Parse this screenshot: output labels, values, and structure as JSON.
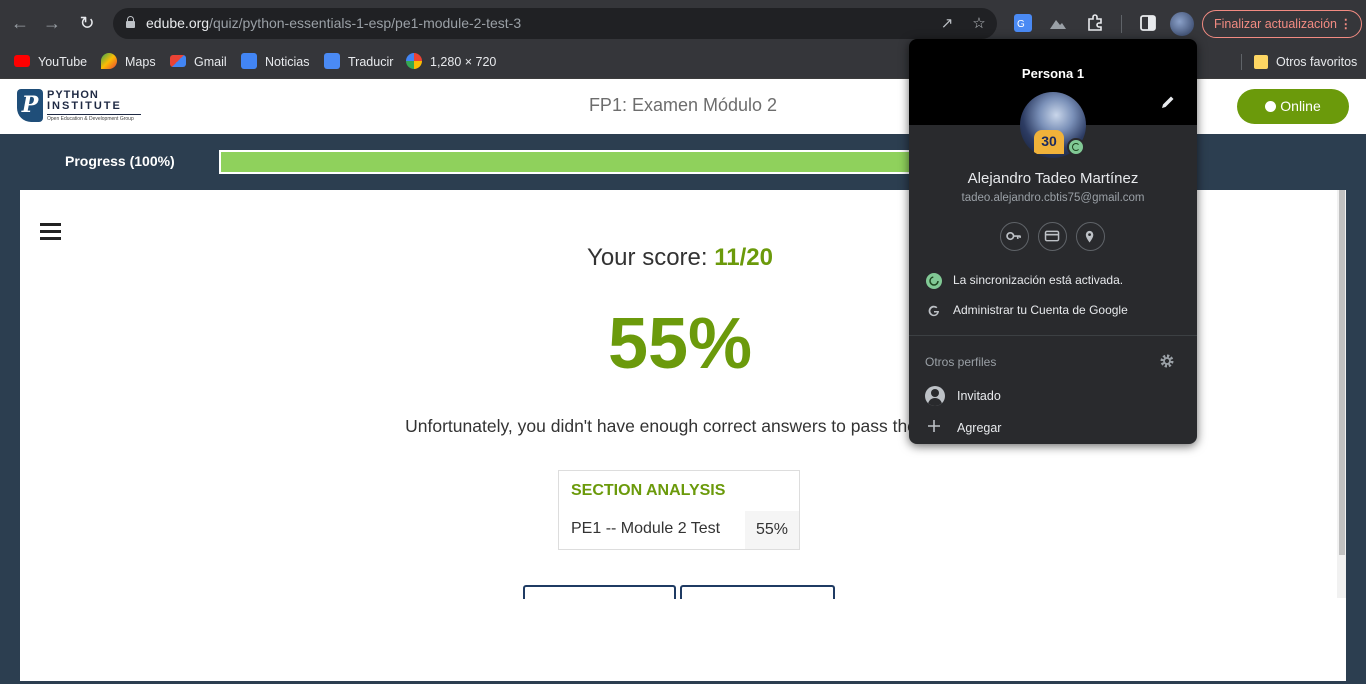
{
  "browser": {
    "url_host": "edube.org",
    "url_path": "/quiz/python-essentials-1-esp/pe1-module-2-test-3",
    "update_label": "Finalizar actualización",
    "bookmarks": [
      "YouTube",
      "Maps",
      "Gmail",
      "Noticias",
      "Traducir",
      "1,280 × 720"
    ],
    "other_bookmarks": "Otros favoritos"
  },
  "header": {
    "logo_line1": "PYTHON",
    "logo_line2": "INSTITUTE",
    "logo_sub": "Open Education & Development Group",
    "title": "FP1: Examen Módulo 2",
    "online_label": "Online"
  },
  "progress": {
    "label": "Progress (100%)",
    "value": 1.0
  },
  "result": {
    "score_prefix": "Your score:",
    "score_value": "11/20",
    "percent": "55%",
    "message": "Unfortunately, you didn't have enough correct answers to pass the test."
  },
  "analysis": {
    "title": "SECTION ANALYSIS",
    "rows": [
      {
        "name": "PE1 -- Module 2 Test",
        "pct": "55%"
      }
    ]
  },
  "profile": {
    "header": "Persona 1",
    "name": "Alejandro Tadeo Martínez",
    "email": "tadeo.alejandro.cbtis75@gmail.com",
    "jersey_number": "30",
    "sync_label": "La sincronización está activada.",
    "manage_label": "Administrar tu Cuenta de Google",
    "others_label": "Otros perfiles",
    "guest_label": "Invitado",
    "add_label": "Agregar"
  },
  "colors": {
    "accent_green": "#6b9a0b",
    "progress_green": "#8fd15c",
    "page_bg": "#2c3e50"
  }
}
